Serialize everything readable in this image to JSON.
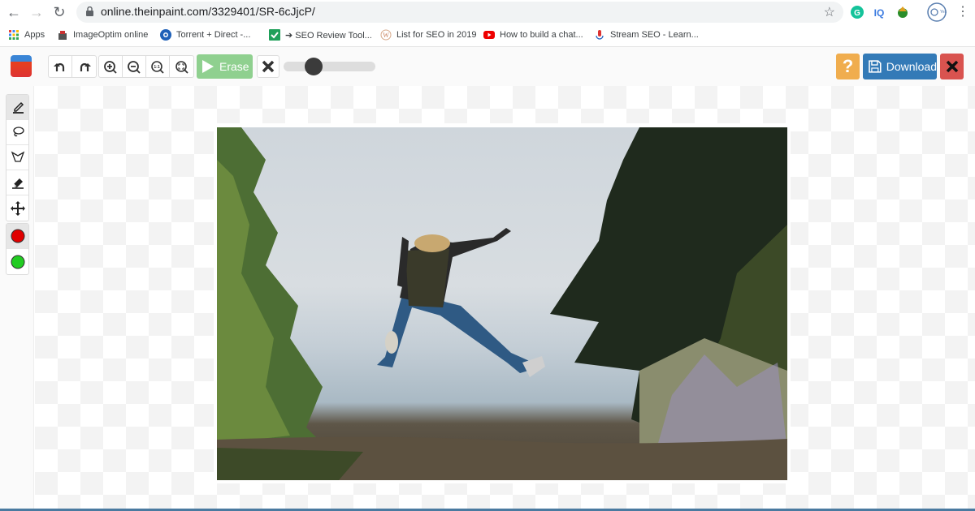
{
  "browser": {
    "url": "online.theinpaint.com/3329401/SR-6cJjcP/",
    "extensions": [
      "grammarly-icon",
      "iq-icon",
      "download-manager-icon",
      "profile-icon"
    ],
    "bookmarks": [
      {
        "label": "Apps",
        "icon": "apps-grid-icon"
      },
      {
        "label": "ImageOptim online",
        "icon": "imageoptim-icon"
      },
      {
        "label": "Torrent + Direct -...",
        "icon": "torrent-icon"
      },
      {
        "label": "➔ SEO Review Tool...",
        "icon": "checkbox-icon"
      },
      {
        "label": "List for SEO in 2019",
        "icon": "wordpress-icon"
      },
      {
        "label": "How to build a chat...",
        "icon": "youtube-icon"
      },
      {
        "label": "Stream SEO - Learn...",
        "icon": "stream-icon"
      }
    ]
  },
  "toolbar": {
    "erase_label": "Erase",
    "download_label": "Download",
    "help_label": "?",
    "brush_size_percent": 33
  },
  "tools": {
    "selection": [
      "marker",
      "lasso",
      "polygon-lasso",
      "eraser",
      "move"
    ],
    "active": "marker",
    "colors": {
      "remove": "#e00000",
      "keep": "#22cc22"
    }
  },
  "canvas": {
    "image_description": "Person jumping with backpack between trees, lake and misty sky"
  }
}
